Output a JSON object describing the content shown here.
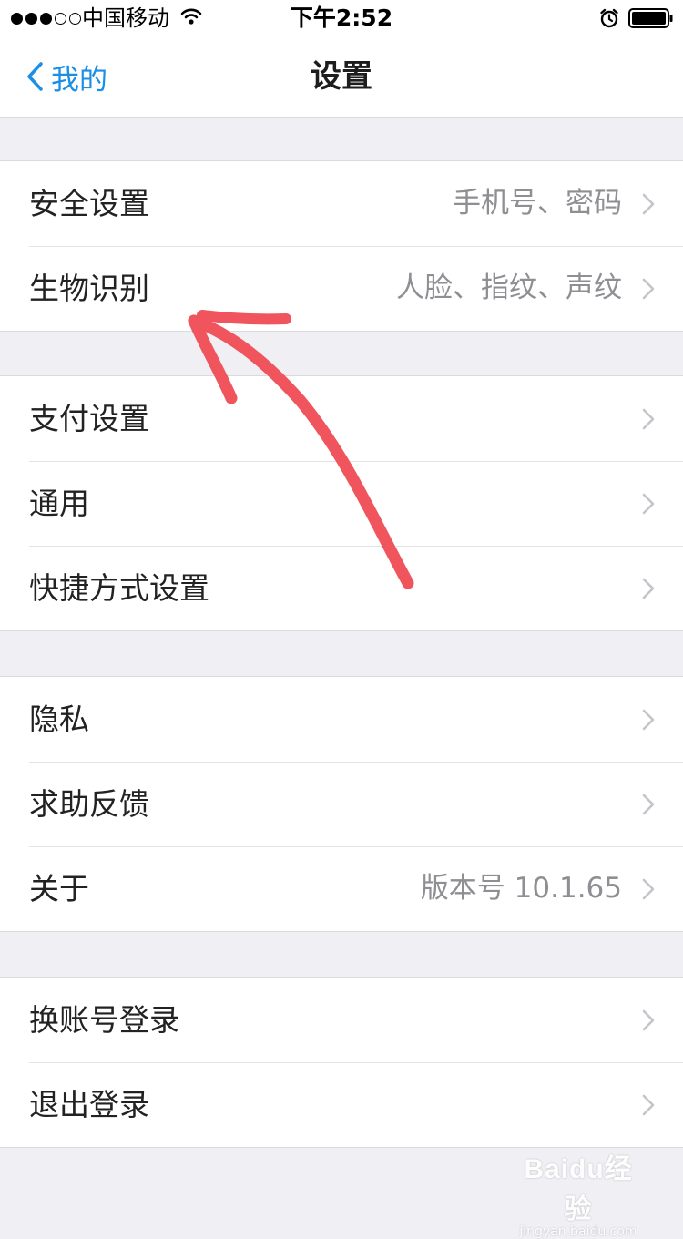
{
  "status_bar": {
    "carrier": "中国移动",
    "time": "下午2:52",
    "signal_filled": 3,
    "signal_total": 5
  },
  "nav": {
    "back_label": "我的",
    "title": "设置"
  },
  "groups": [
    {
      "rows": [
        {
          "label": "安全设置",
          "detail": "手机号、密码"
        },
        {
          "label": "生物识别",
          "detail": "人脸、指纹、声纹"
        }
      ]
    },
    {
      "rows": [
        {
          "label": "支付设置",
          "detail": ""
        },
        {
          "label": "通用",
          "detail": ""
        },
        {
          "label": "快捷方式设置",
          "detail": ""
        }
      ]
    },
    {
      "rows": [
        {
          "label": "隐私",
          "detail": ""
        },
        {
          "label": "求助反馈",
          "detail": ""
        },
        {
          "label": "关于",
          "detail": "版本号 10.1.65"
        }
      ]
    },
    {
      "rows": [
        {
          "label": "换账号登录",
          "detail": ""
        },
        {
          "label": "退出登录",
          "detail": ""
        }
      ]
    }
  ],
  "colors": {
    "accent": "#1b8ee6",
    "background": "#efeff4",
    "annotation_arrow": "#f0545c"
  },
  "watermark": {
    "logo": "Baidu经验",
    "url": "jingyan.baidu.com"
  }
}
